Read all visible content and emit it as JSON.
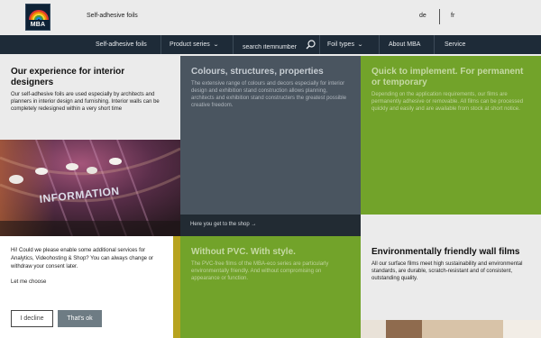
{
  "header": {
    "logo_text": "MBA",
    "breadcrumb": "Self-adhesive foils",
    "languages": [
      "de",
      "fr"
    ]
  },
  "nav": {
    "items": [
      {
        "label": "Self-adhesive foils"
      },
      {
        "label": "Product series"
      },
      {
        "label": "Foil types"
      },
      {
        "label": "About MBA"
      },
      {
        "label": "Service"
      }
    ],
    "search": {
      "placeholder": "search itemnumber",
      "value": ""
    }
  },
  "tiles": {
    "experience": {
      "title": "Our experience for interior designers",
      "text": "Our self-adhesive foils are used especially by architects and planners in interior design and furnishing. Interior walls can be completely redesigned within a very short time"
    },
    "colours": {
      "title": "Colours, structures, properties",
      "text": "The extensive range of colours and decors especially for interior design and exhibition stand construction allows planning, architects and exhibition stand constructers the greatest possible creative freedom.",
      "shop_link": "Here you get to the shop →"
    },
    "quick": {
      "title": "Quick to implement. For permanent or temporary",
      "text": "Depending on the application requirements, our films are permanently adhesive or removable. All films can be processed quickly and easily and are available from stock at short notice."
    },
    "photo": {
      "overlay_text": "INFORMATION"
    },
    "pvc": {
      "title": "Without PVC. With style.",
      "text": "The PVC-free films of the MBA-eco series are particularly environmentally friendly. And without compromising on appearance or function."
    },
    "eco": {
      "title": "Environmentally friendly wall films",
      "text": "All our surface films meet high sustainability and environmental standards, are durable, scratch-resistant and of consistent, outstanding quality."
    }
  },
  "consent": {
    "text": "Hi! Could we please enable some additional services for Analytics, Videohosting & Shop? You can always change or withdraw your consent later.",
    "let_me_choose": "Let me choose",
    "decline_label": "I decline",
    "accept_label": "That's ok"
  },
  "colors": {
    "nav_bg": "#1e2b38",
    "slate_tile": "#4a5560",
    "green_tile": "#72a32a",
    "page_bg": "#ebebeb"
  }
}
